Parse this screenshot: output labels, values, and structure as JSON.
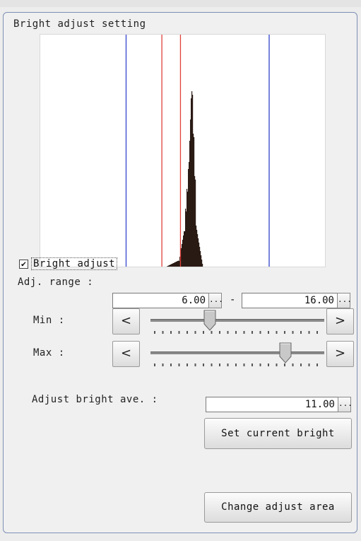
{
  "panel": {
    "title": "Bright adjust setting"
  },
  "histogram": {
    "red_levels": [
      8.5,
      9.8
    ],
    "blue_levels": [
      6.0,
      16.0
    ]
  },
  "bright_adjust": {
    "label": "Bright adjust",
    "checked": true,
    "check_glyph": "✔"
  },
  "adj_range": {
    "label": "Adj. range :",
    "min_value": "6.00",
    "max_value": "16.00",
    "separator": "-",
    "browse_label": "...",
    "min_label": "Min :",
    "max_label": "Max :",
    "min_fraction": 0.33,
    "max_fraction": 0.8
  },
  "arrows": {
    "left": "<",
    "right": ">"
  },
  "adjust_bright_ave": {
    "label": "Adjust bright ave. :",
    "value": "11.00",
    "browse_label": "..."
  },
  "buttons": {
    "set_current_bright": "Set current bright",
    "change_adjust_area": "Change adjust area"
  }
}
